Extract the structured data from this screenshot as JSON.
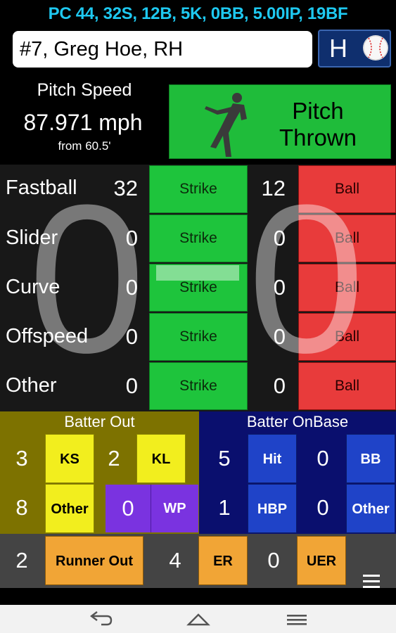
{
  "header": {
    "stats": "PC 44, 32S, 12B, 5K, 0BB, 5.00IP, 19BF"
  },
  "pitcher": {
    "name": "#7, Greg Hoe, RH",
    "home_away": "H",
    "ball_icon": "baseball-icon"
  },
  "speed": {
    "title": "Pitch Speed",
    "value": "87.971 mph",
    "distance": "from 60.5'"
  },
  "pitch_button": {
    "line1": "Pitch",
    "line2": "Thrown",
    "icon": "pitcher-silhouette-icon"
  },
  "pitch_types": [
    {
      "name": "Fastball",
      "strikes": "32",
      "strike_label": "Strike",
      "balls": "12",
      "ball_label": "Ball"
    },
    {
      "name": "Slider",
      "strikes": "0",
      "strike_label": "Strike",
      "balls": "0",
      "ball_label": "Ball"
    },
    {
      "name": "Curve",
      "strikes": "0",
      "strike_label": "Strike",
      "balls": "0",
      "ball_label": "Ball"
    },
    {
      "name": "Offspeed",
      "strikes": "0",
      "strike_label": "Strike",
      "balls": "0",
      "ball_label": "Ball"
    },
    {
      "name": "Other",
      "strikes": "0",
      "strike_label": "Strike",
      "balls": "0",
      "ball_label": "Ball"
    }
  ],
  "count": {
    "balls": "0",
    "strikes": "0"
  },
  "batter_out": {
    "title": "Batter Out",
    "ks_count": "3",
    "ks_label": "KS",
    "kl_count": "2",
    "kl_label": "KL",
    "other_count": "8",
    "other_label": "Other",
    "wp_count": "0",
    "wp_label": "WP"
  },
  "batter_onbase": {
    "title": "Batter OnBase",
    "hit_count": "5",
    "hit_label": "Hit",
    "bb_count": "0",
    "bb_label": "BB",
    "hbp_count": "1",
    "hbp_label": "HBP",
    "other_count": "0",
    "other_label": "Other"
  },
  "runner": {
    "runner_out_count": "2",
    "runner_out_label": "Runner Out",
    "er_count": "4",
    "er_label": "ER",
    "uer_count": "0",
    "uer_label": "UER"
  },
  "colors": {
    "stats": "#1ec8f0",
    "strike": "#1ec43c",
    "ball": "#e83b3b",
    "out_panel": "#7d7200",
    "onbase_panel": "#0a0f6e"
  }
}
